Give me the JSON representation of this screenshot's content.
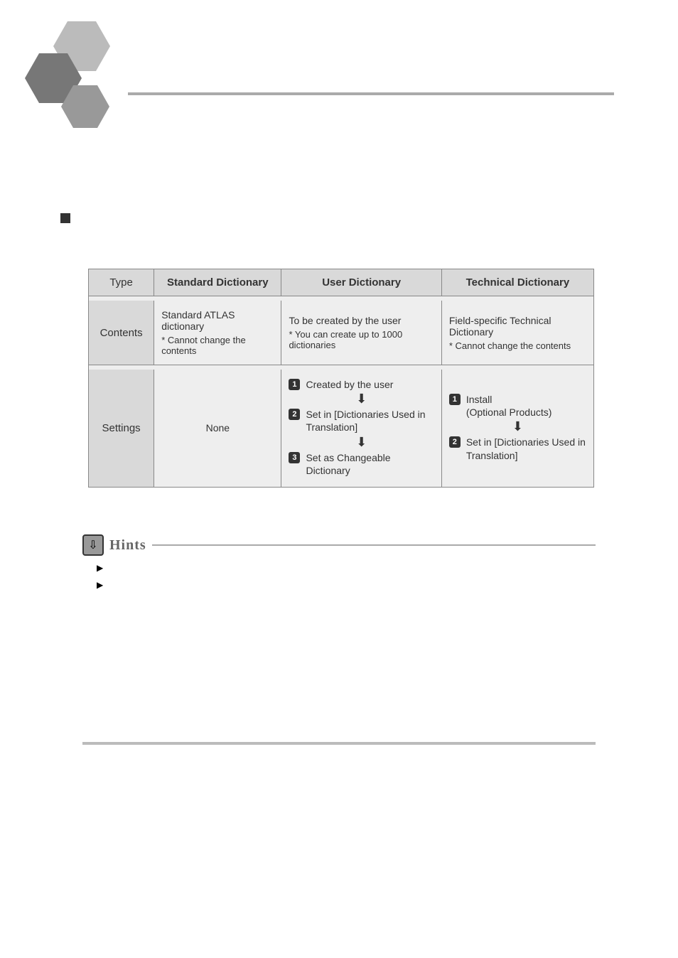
{
  "table": {
    "headers": {
      "type": "Type",
      "standard": "Standard Dictionary",
      "user": "User Dictionary",
      "technical": "Technical Dictionary"
    },
    "rows": {
      "contents": {
        "label": "Contents",
        "standard_main": "Standard ATLAS dictionary",
        "standard_note": "* Cannot change the contents",
        "user_main": "To be created by the user",
        "user_note": "* You can create up to 1000 dictionaries",
        "tech_main": "Field-specific Technical Dictionary",
        "tech_note": "* Cannot change the contents"
      },
      "settings": {
        "label": "Settings",
        "standard": "None",
        "user_step1": "Created by the user",
        "user_step2": "Set in [Dictionaries Used in Translation]",
        "user_step3": "Set as Changeable Dictionary",
        "tech_step1a": "Install",
        "tech_step1b": "(Optional Products)",
        "tech_step2": "Set in [Dictionaries Used in Translation]"
      }
    }
  },
  "hints": {
    "label": "Hints"
  }
}
